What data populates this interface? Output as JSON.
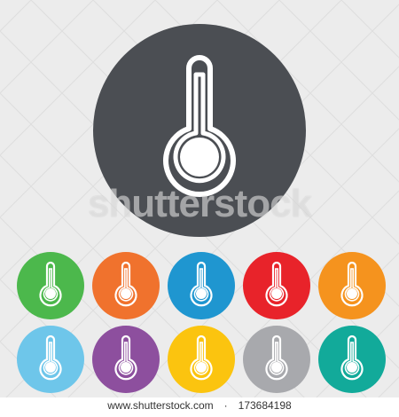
{
  "watermark": "shutterstock",
  "footer": {
    "site": "www.shutterstock.com",
    "separator": "·",
    "image_id": "173684198"
  },
  "colors": {
    "background": "#ececec",
    "big_circle": "#4b4e53",
    "glyph": "#ffffff",
    "row1": [
      "#4cb84c",
      "#f0722d",
      "#1f96d0",
      "#e8232a",
      "#f5931e"
    ],
    "row2": [
      "#6ec6ea",
      "#8d4f9e",
      "#fbc40f",
      "#a8a9ad",
      "#12aa9a"
    ]
  },
  "icons": {
    "big": "thermometer-icon",
    "small": "thermometer-icon"
  }
}
